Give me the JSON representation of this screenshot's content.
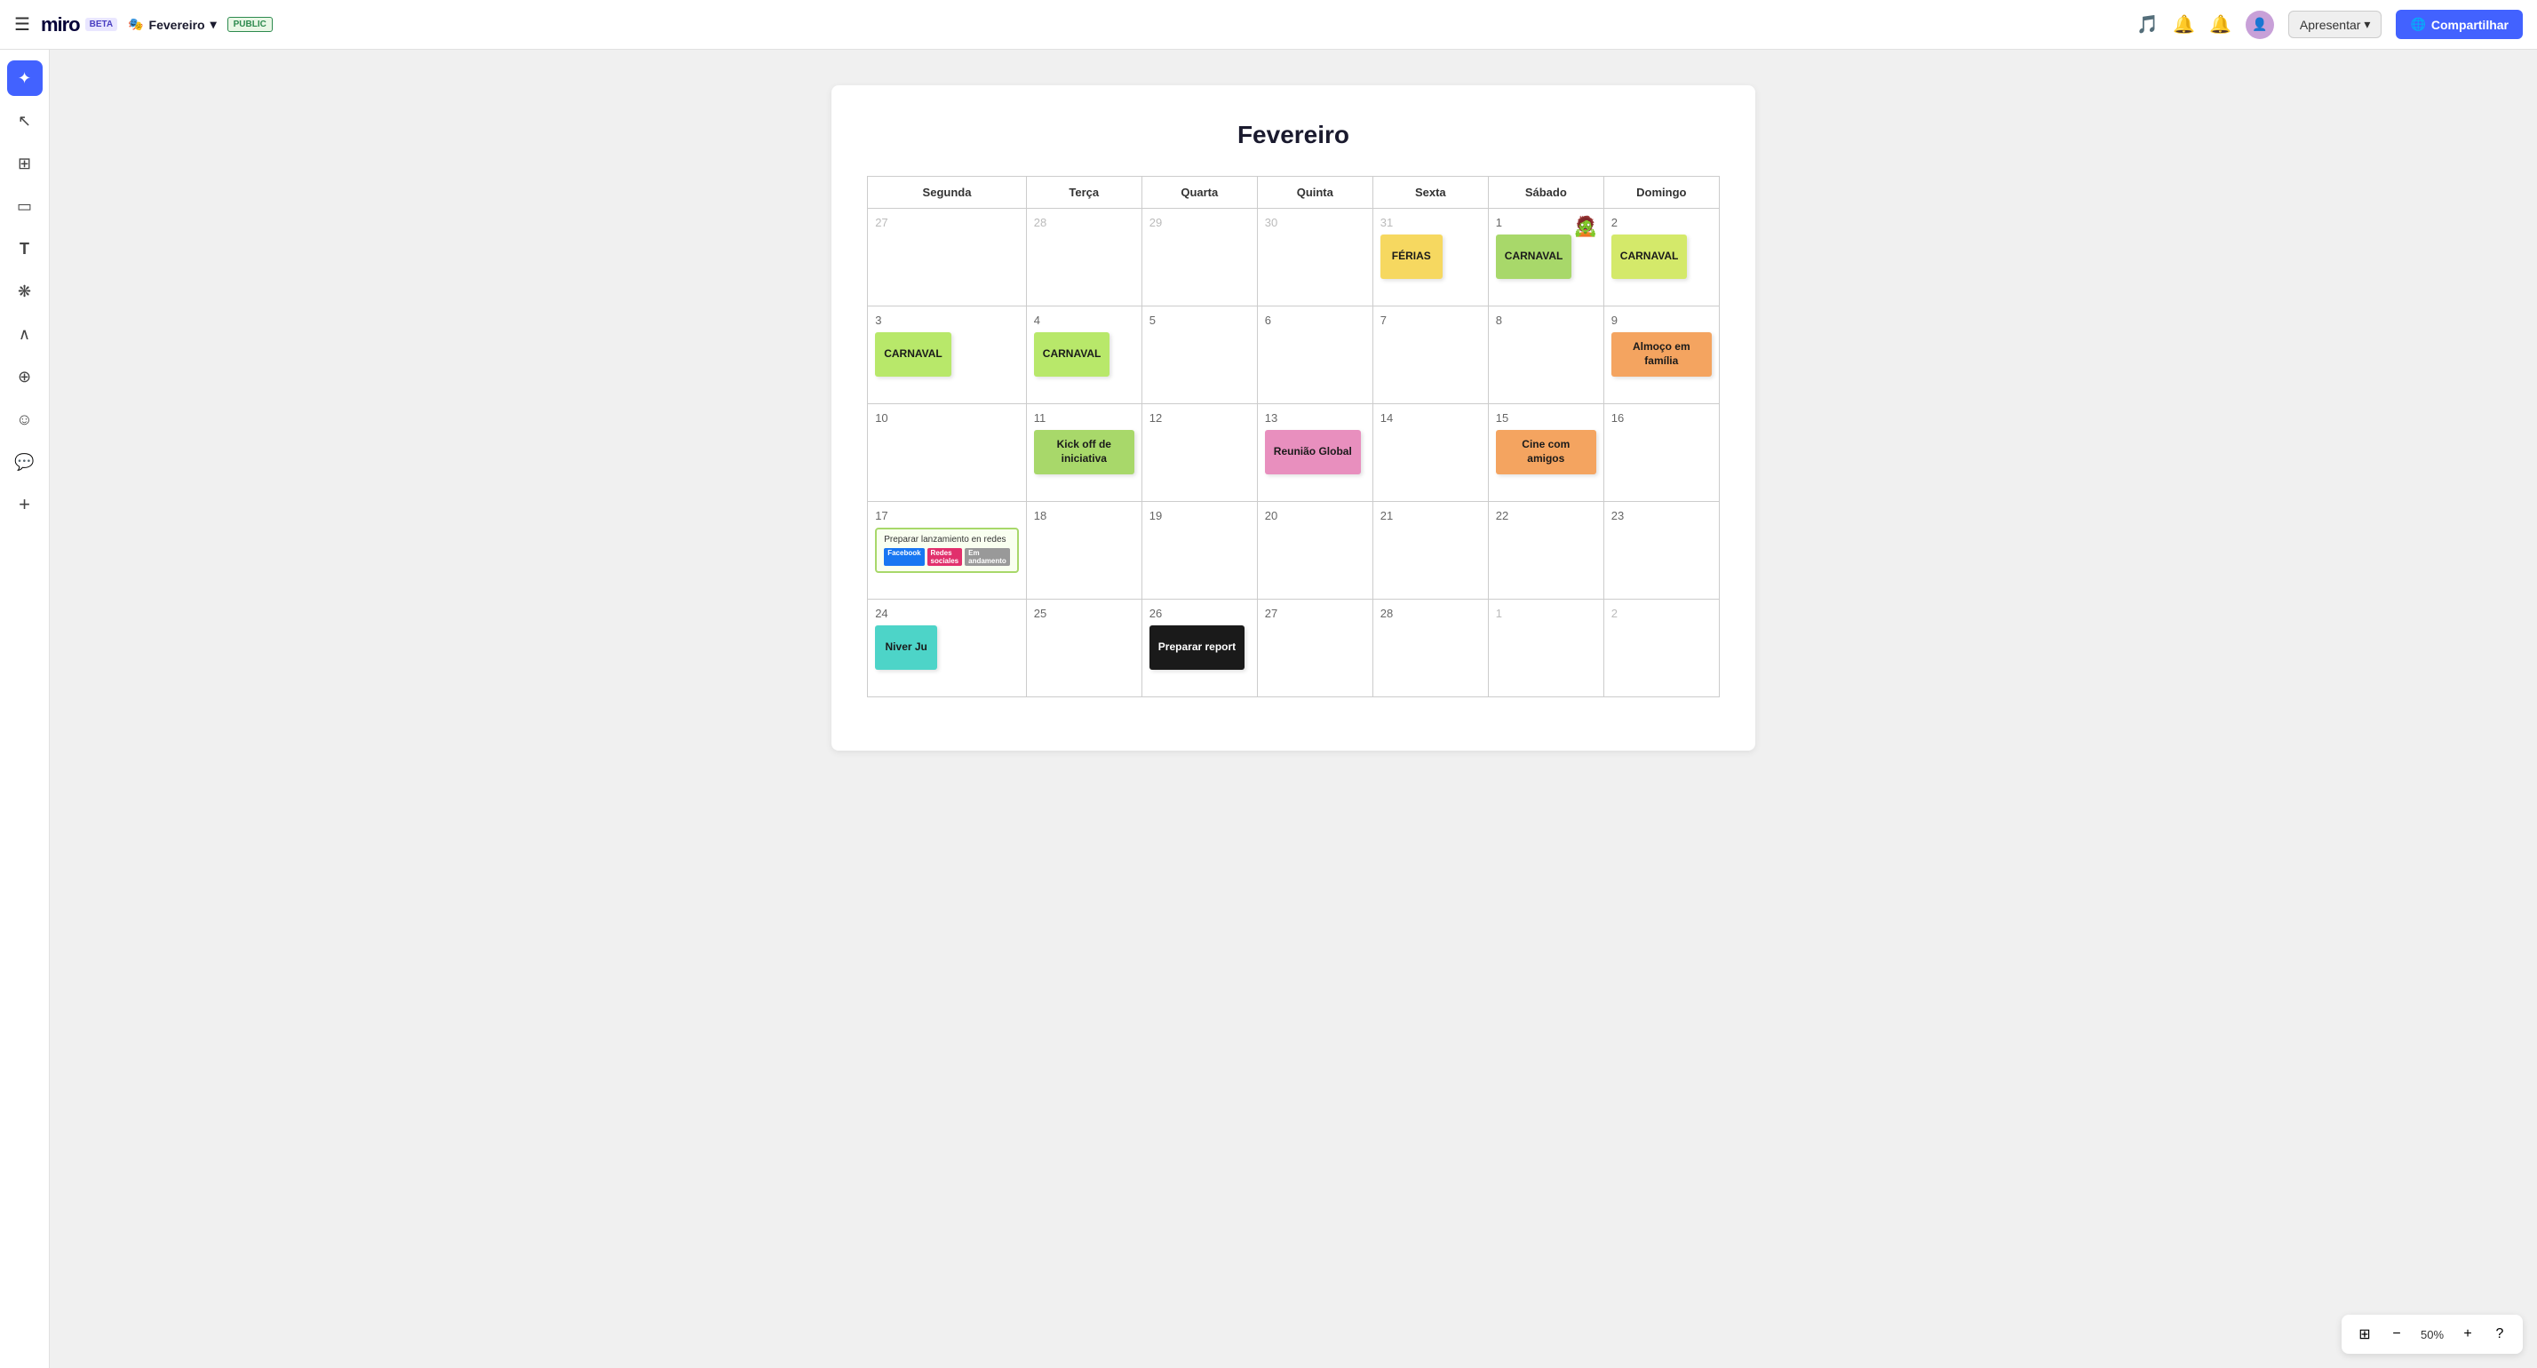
{
  "app": {
    "name": "miro",
    "beta_label": "BETA"
  },
  "board": {
    "emoji": "🎭",
    "name": "Fevereiro",
    "visibility": "PUBLIC"
  },
  "topbar": {
    "present_label": "Apresentar",
    "share_label": "Compartilhar",
    "share_icon": "🌐"
  },
  "calendar": {
    "title": "Fevereiro",
    "weekdays": [
      "Segunda",
      "Terça",
      "Quarta",
      "Quinta",
      "Sexta",
      "Sábado",
      "Domingo"
    ],
    "weeks": [
      {
        "days": [
          {
            "num": "27",
            "other": true,
            "notes": []
          },
          {
            "num": "28",
            "other": true,
            "notes": []
          },
          {
            "num": "29",
            "other": true,
            "notes": []
          },
          {
            "num": "30",
            "other": true,
            "notes": []
          },
          {
            "num": "31",
            "other": true,
            "notes": [
              {
                "text": "FÉRIAS",
                "color": "yellow"
              }
            ]
          },
          {
            "num": "1",
            "other": false,
            "sticker": "🧟",
            "notes": [
              {
                "text": "CARNAVAL",
                "color": "green"
              }
            ]
          },
          {
            "num": "2",
            "other": false,
            "notes": [
              {
                "text": "CARNAVAL",
                "color": "yellow-light"
              }
            ]
          }
        ]
      },
      {
        "days": [
          {
            "num": "3",
            "other": false,
            "notes": [
              {
                "text": "CARNAVAL",
                "color": "green2"
              }
            ]
          },
          {
            "num": "4",
            "other": false,
            "notes": [
              {
                "text": "CARNAVAL",
                "color": "green2"
              }
            ]
          },
          {
            "num": "5",
            "other": false,
            "notes": []
          },
          {
            "num": "6",
            "other": false,
            "notes": []
          },
          {
            "num": "7",
            "other": false,
            "notes": []
          },
          {
            "num": "8",
            "other": false,
            "notes": []
          },
          {
            "num": "9",
            "other": false,
            "notes": [
              {
                "text": "Almoço em família",
                "color": "orange"
              }
            ]
          }
        ]
      },
      {
        "days": [
          {
            "num": "10",
            "other": false,
            "notes": []
          },
          {
            "num": "11",
            "other": false,
            "notes": [
              {
                "text": "Kick off de iniciativa",
                "color": "green"
              }
            ]
          },
          {
            "num": "12",
            "other": false,
            "notes": []
          },
          {
            "num": "13",
            "other": false,
            "notes": [
              {
                "text": "Reunião Global",
                "color": "pink"
              }
            ]
          },
          {
            "num": "14",
            "other": false,
            "notes": []
          },
          {
            "num": "15",
            "other": false,
            "notes": [
              {
                "text": "Cine com amigos",
                "color": "orange"
              }
            ]
          },
          {
            "num": "16",
            "other": false,
            "notes": []
          }
        ]
      },
      {
        "days": [
          {
            "num": "17",
            "other": false,
            "card": {
              "title": "Preparar lanzamiento en redes",
              "badges": [
                {
                  "label": "Facebook",
                  "cls": "badge-fb"
                },
                {
                  "label": "Redes sociales",
                  "cls": "badge-insta"
                },
                {
                  "label": "Em andamento",
                  "cls": "badge-status"
                }
              ]
            }
          },
          {
            "num": "18",
            "other": false,
            "notes": []
          },
          {
            "num": "19",
            "other": false,
            "notes": []
          },
          {
            "num": "20",
            "other": false,
            "notes": []
          },
          {
            "num": "21",
            "other": false,
            "notes": []
          },
          {
            "num": "22",
            "other": false,
            "notes": []
          },
          {
            "num": "23",
            "other": false,
            "notes": []
          }
        ]
      },
      {
        "days": [
          {
            "num": "24",
            "other": false,
            "notes": [
              {
                "text": "Niver Ju",
                "color": "teal"
              }
            ]
          },
          {
            "num": "25",
            "other": false,
            "notes": []
          },
          {
            "num": "26",
            "other": false,
            "notes": [
              {
                "text": "Preparar report",
                "color": "black"
              }
            ]
          },
          {
            "num": "27",
            "other": false,
            "notes": []
          },
          {
            "num": "28",
            "other": false,
            "notes": []
          },
          {
            "num": "1",
            "other": true,
            "notes": []
          },
          {
            "num": "2",
            "other": true,
            "notes": []
          }
        ]
      }
    ]
  },
  "sidebar": {
    "items": [
      {
        "icon": "✦",
        "label": "AI",
        "active": true
      },
      {
        "icon": "↖",
        "label": "Select",
        "active": false
      },
      {
        "icon": "⊞",
        "label": "Frames",
        "active": false
      },
      {
        "icon": "▭",
        "label": "Sticky Note",
        "active": false
      },
      {
        "icon": "T",
        "label": "Text",
        "active": false
      },
      {
        "icon": "❋",
        "label": "Shapes",
        "active": false
      },
      {
        "icon": "∧",
        "label": "Draw",
        "active": false
      },
      {
        "icon": "⊕",
        "label": "Crop",
        "active": false
      },
      {
        "icon": "☺",
        "label": "Reactions",
        "active": false
      },
      {
        "icon": "💬",
        "label": "Comment",
        "active": false
      },
      {
        "icon": "+",
        "label": "Add",
        "active": false
      }
    ]
  },
  "zoom": {
    "level": "50%",
    "fit_icon": "⊞",
    "minus_icon": "−",
    "plus_icon": "+",
    "help_icon": "?"
  }
}
